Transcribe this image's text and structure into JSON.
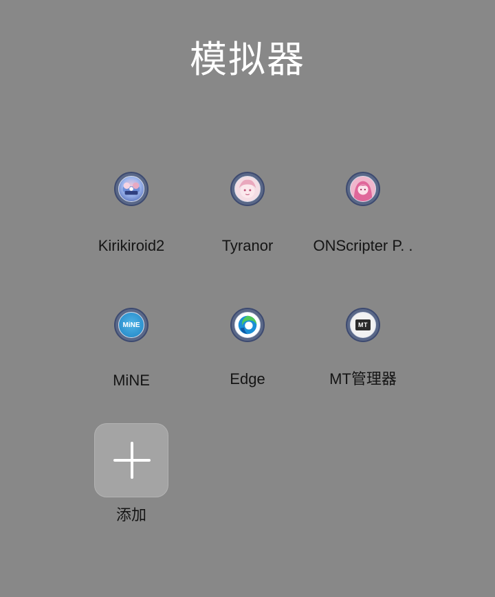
{
  "folder": {
    "title": "模拟器"
  },
  "apps": [
    {
      "label": "Kirikiroid2",
      "icon": "kirikiroid2-icon"
    },
    {
      "label": "Tyranor",
      "icon": "tyranor-icon"
    },
    {
      "label": "ONScripter P. .",
      "icon": "onscripter-icon"
    },
    {
      "label": "MiNE",
      "icon": "mine-icon",
      "icon_text": "MiNE"
    },
    {
      "label": "Edge",
      "icon": "edge-icon"
    },
    {
      "label": "MT管理器",
      "icon": "mt-manager-icon",
      "icon_text": "MT"
    }
  ],
  "add": {
    "label": "添加",
    "icon": "plus-icon"
  },
  "colors": {
    "background": "#888888",
    "title": "#ffffff",
    "label": "#151515",
    "icon_ring": "#3d4a70",
    "add_tile": "#a4a4a4"
  }
}
